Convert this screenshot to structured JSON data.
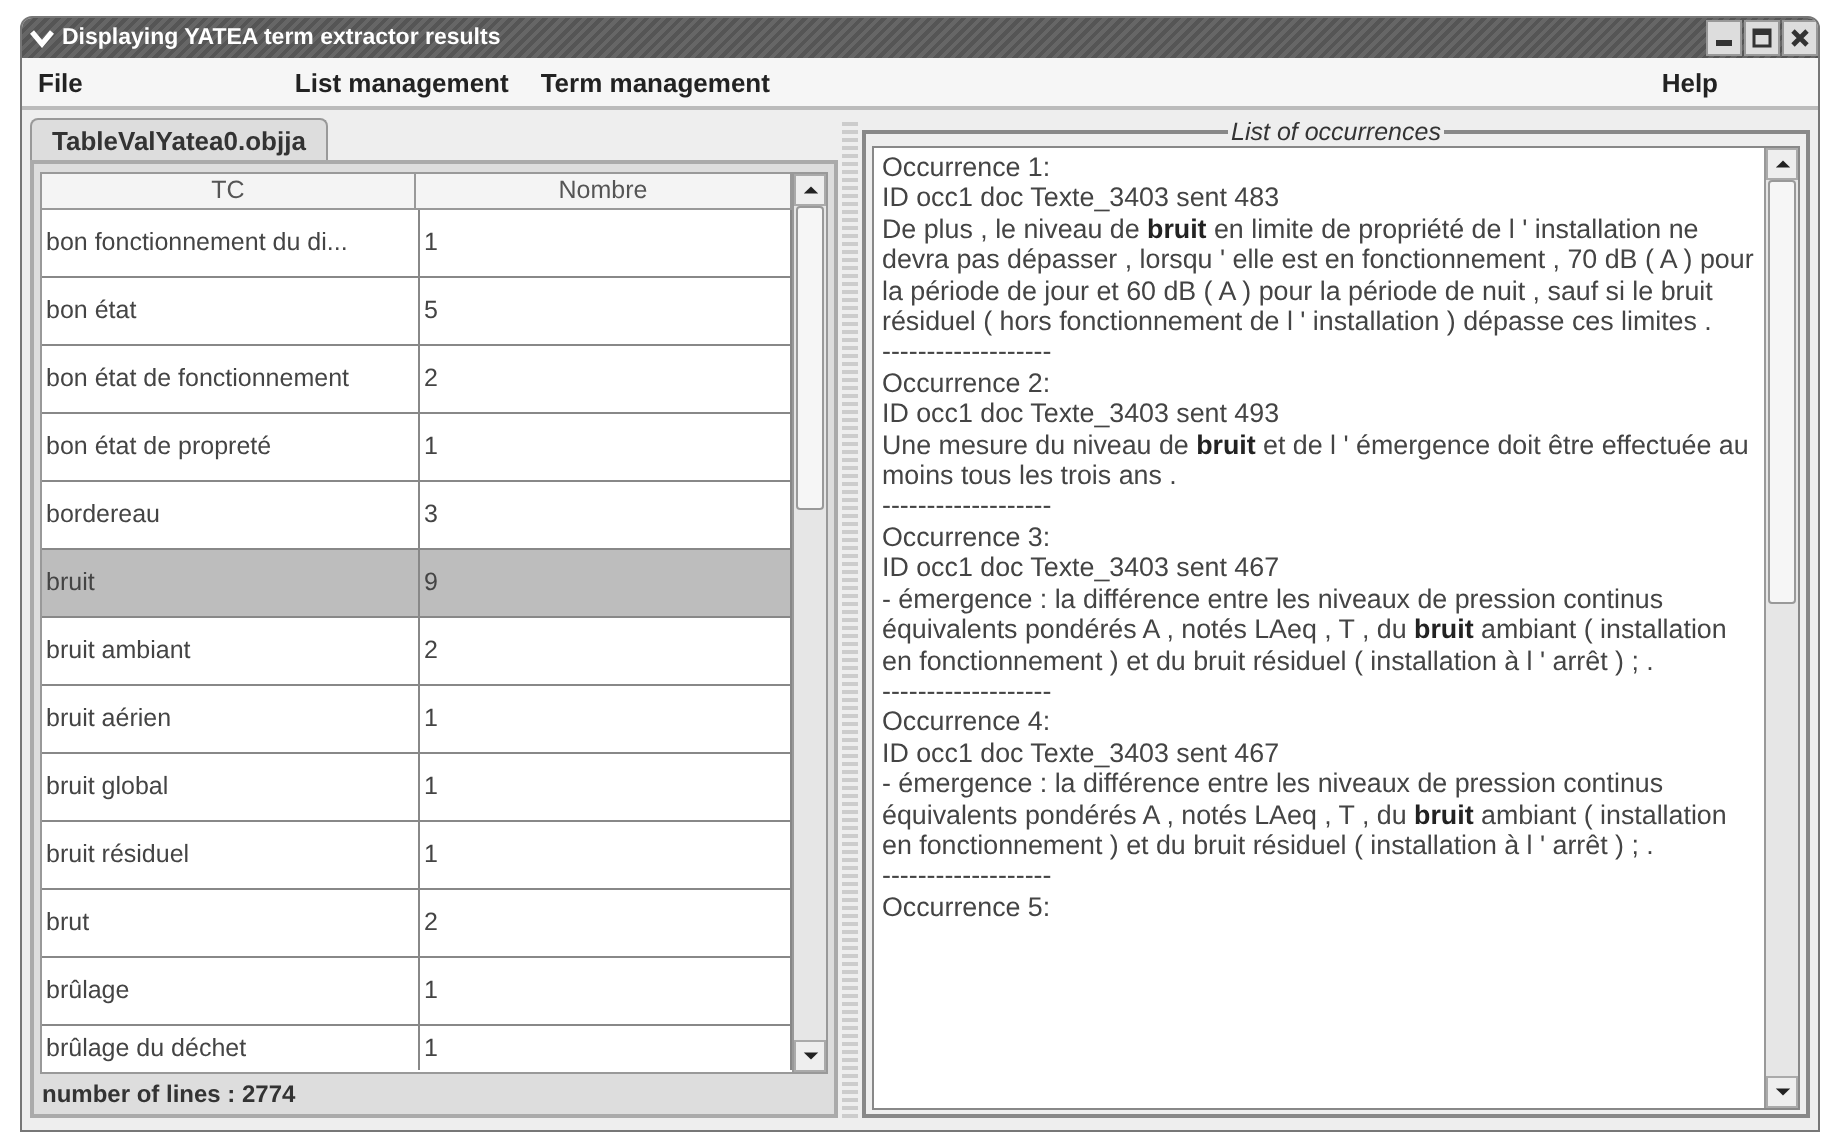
{
  "window": {
    "title": "Displaying YATEA term extractor results"
  },
  "menu": [
    "File",
    "List management",
    "Term management",
    "Help"
  ],
  "tab": {
    "label": "TableValYatea0.objja",
    "selected": true
  },
  "table": {
    "columns": [
      "TC",
      "Nombre"
    ],
    "rows": [
      {
        "term": "bon fonctionnement du di...",
        "count": "1",
        "selected": false
      },
      {
        "term": "bon état",
        "count": "5",
        "selected": false
      },
      {
        "term": "bon état de fonctionnement",
        "count": "2",
        "selected": false
      },
      {
        "term": "bon état de propreté",
        "count": "1",
        "selected": false
      },
      {
        "term": "bordereau",
        "count": "3",
        "selected": false
      },
      {
        "term": "bruit",
        "count": "9",
        "selected": true
      },
      {
        "term": "bruit ambiant",
        "count": "2",
        "selected": false
      },
      {
        "term": "bruit aérien",
        "count": "1",
        "selected": false
      },
      {
        "term": "bruit global",
        "count": "1",
        "selected": false
      },
      {
        "term": "bruit résiduel",
        "count": "1",
        "selected": false
      },
      {
        "term": "brut",
        "count": "2",
        "selected": false
      },
      {
        "term": "brûlage",
        "count": "1",
        "selected": false
      },
      {
        "term": "brûlage du déchet",
        "count": "1",
        "selected": false
      }
    ]
  },
  "status": "number of lines : 2774",
  "occurrences": {
    "title": "List of occurrences",
    "entries": [
      {
        "heading": "Occurrence 1:",
        "id": "ID occ1 doc Texte_3403 sent 483",
        "text": "De plus , le niveau de **bruit** en limite de propriété de l ' installation ne devra pas dépasser , lorsqu ' elle est en fonctionnement , 70 dB ( A ) pour la période de jour et 60 dB ( A ) pour la période de nuit , sauf si le bruit résiduel ( hors fonctionnement de l ' installation ) dépasse ces limites .",
        "separator": "-------------------"
      },
      {
        "heading": "Occurrence 2:",
        "id": "ID occ1 doc Texte_3403 sent 493",
        "text": "Une mesure du niveau de **bruit** et de l ' émergence doit être effectuée au moins tous les trois ans .",
        "separator": "-------------------"
      },
      {
        "heading": "Occurrence 3:",
        "id": "ID occ1 doc Texte_3403 sent 467",
        "text": "- émergence : la différence entre les niveaux de pression continus équivalents pondérés A , notés LAeq , T , du **bruit** ambiant ( installation en fonctionnement ) et du bruit résiduel ( installation à l ' arrêt ) ; .",
        "separator": "-------------------"
      },
      {
        "heading": "Occurrence 4:",
        "id": "ID occ1 doc Texte_3403 sent 467",
        "text": "- émergence : la différence entre les niveaux de pression continus équivalents pondérés A , notés LAeq , T , du **bruit** ambiant ( installation en fonctionnement ) et du bruit résiduel ( installation à l ' arrêt ) ; .",
        "separator": "-------------------"
      },
      {
        "heading": "Occurrence 5:"
      }
    ]
  }
}
